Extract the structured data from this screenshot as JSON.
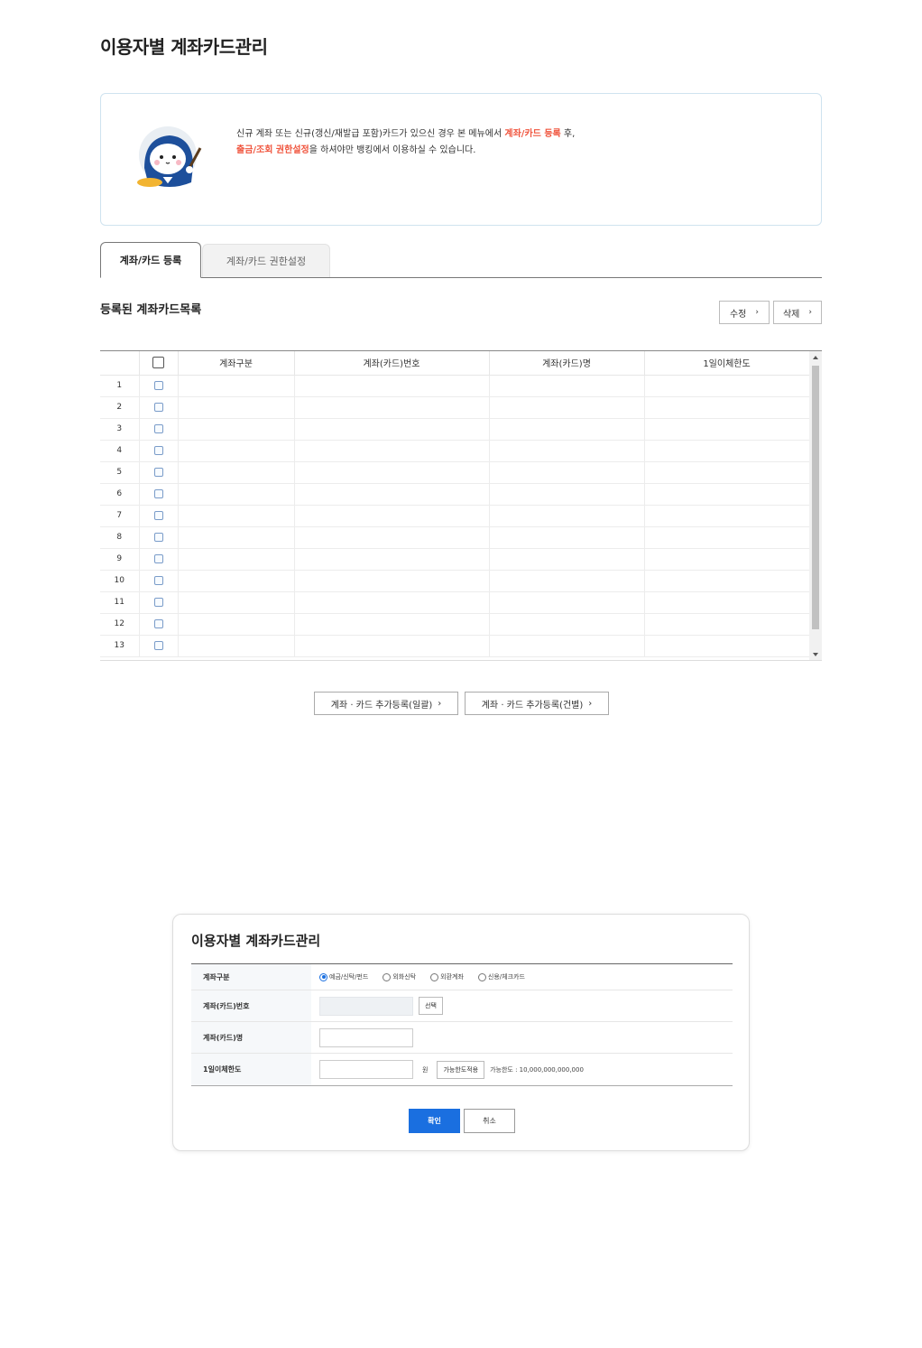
{
  "page": {
    "title": "이용자별 계좌카드관리"
  },
  "notice": {
    "line1_pre": "신규 계좌 또는 신규(갱신/재발급 포함)카드가 있으신 경우 본 메뉴에서 ",
    "line1_hl": "계좌/카드 등록",
    "line1_post": " 후,",
    "line2_hl": "출금/조회 권한설정",
    "line2_post": "을 하셔야만 뱅킹에서 이용하실 수 있습니다."
  },
  "tabs": [
    {
      "label": "계좌/카드 등록",
      "active": true
    },
    {
      "label": "계좌/카드 권한설정",
      "active": false
    }
  ],
  "section": {
    "title": "등록된 계좌카드목록"
  },
  "actions": {
    "edit": "수정",
    "delete": "삭제"
  },
  "grid": {
    "columns": [
      "계좌구분",
      "계좌(카드)번호",
      "계좌(카드)명",
      "1일이체한도"
    ],
    "rows": [
      "1",
      "2",
      "3",
      "4",
      "5",
      "6",
      "7",
      "8",
      "9",
      "10",
      "11",
      "12",
      "13"
    ]
  },
  "add_buttons": {
    "bulk": "계좌 · 카드 추가등록(일괄)",
    "single": "계좌 · 카드 추가등록(건별)"
  },
  "modal": {
    "title": "이용자별 계좌카드관리",
    "labels": {
      "type": "계좌구분",
      "number": "계좌(카드)번호",
      "name": "계좌(카드)명",
      "limit": "1일이체한도"
    },
    "type_options": [
      "예금/신탁/펀드",
      "외화신탁",
      "외환계좌",
      "신용/체크카드"
    ],
    "type_selected": 0,
    "select_button": "선택",
    "unit": "원",
    "apply_limit_button": "가능한도적용",
    "available_limit": "가능한도 : 10,000,000,000,000",
    "ok": "확인",
    "cancel": "취소"
  },
  "colors": {
    "accent": "#1a6fe0",
    "highlight": "#f0553e"
  }
}
